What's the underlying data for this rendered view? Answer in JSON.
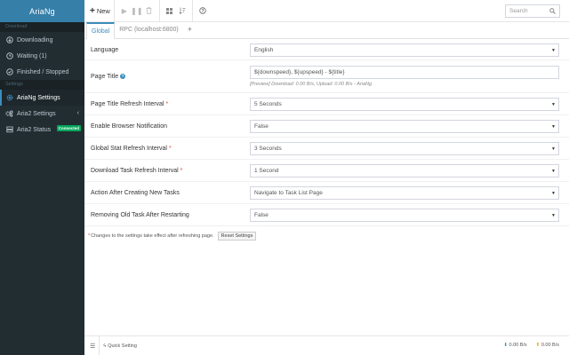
{
  "app": {
    "name": "AriaNg"
  },
  "sidebar": {
    "download_header": "Download",
    "items": [
      {
        "label": "Downloading",
        "icon": "arrow-circle-down-icon"
      },
      {
        "label": "Waiting (1)",
        "icon": "clock-icon"
      },
      {
        "label": "Finished / Stopped",
        "icon": "check-circle-icon"
      }
    ],
    "settings_header": "Settings",
    "settings_items": [
      {
        "label": "AriaNg Settings",
        "icon": "gear-icon"
      },
      {
        "label": "Aria2 Settings",
        "icon": "gears-icon"
      },
      {
        "label": "Aria2 Status",
        "icon": "server-icon",
        "badge": "Connected"
      }
    ]
  },
  "toolbar": {
    "new_label": "New",
    "search_placeholder": "Search"
  },
  "tabs": [
    {
      "label": "Global"
    },
    {
      "label": "RPC (localhost:6800)"
    }
  ],
  "settings": {
    "language": {
      "label": "Language",
      "value": "English"
    },
    "page_title": {
      "label": "Page Title",
      "value": "${downspeed}, ${upspeed} - ${title}",
      "preview": "[Preview] Download: 0.00 B/s, Upload: 0.00 B/s - AriaNg"
    },
    "title_refresh": {
      "label": "Page Title Refresh Interval",
      "value": "5 Seconds"
    },
    "browser_notification": {
      "label": "Enable Browser Notification",
      "value": "False"
    },
    "global_stat_refresh": {
      "label": "Global Stat Refresh Interval",
      "value": "3 Seconds"
    },
    "task_refresh": {
      "label": "Download Task Refresh Interval",
      "value": "1 Second"
    },
    "after_create": {
      "label": "Action After Creating New Tasks",
      "value": "Navigate to Task List Page"
    },
    "remove_old": {
      "label": "Removing Old Task After Restarting",
      "value": "False"
    },
    "note": "Changes to the settings take effect after refreshing page.",
    "reset_label": "Reset Settings"
  },
  "footer": {
    "quick_setting": "Quick Setting",
    "download_speed": "0.00 B/s",
    "upload_speed": "0.00 B/s"
  },
  "colors": {
    "sidebar_bg": "#222d32",
    "logo_bg": "#367fa9",
    "accent": "#3c8dbc",
    "connected": "#00a65a",
    "required": "#dd4b39"
  }
}
